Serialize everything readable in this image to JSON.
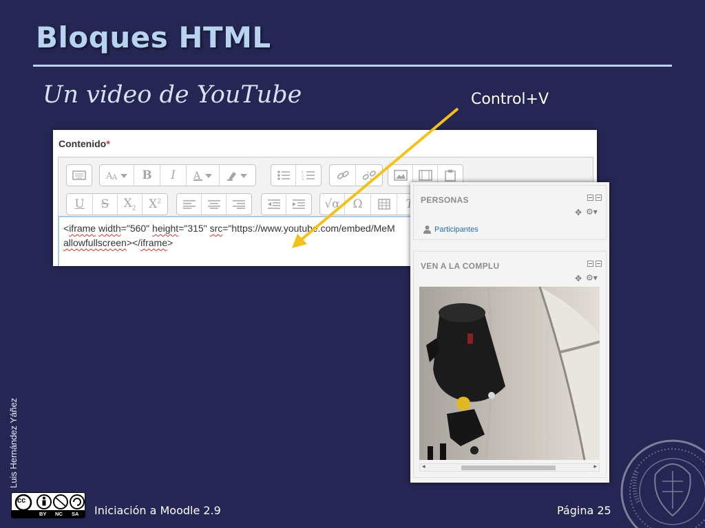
{
  "slide": {
    "title": "Bloques HTML",
    "subtitle": "Un video de YouTube",
    "shortcut_hint": "Control+V",
    "author": "Luis Hernández Yáñez",
    "course": "Iniciación a Moodle 2.9",
    "page": "Página 25"
  },
  "license": {
    "by": "BY",
    "nc": "NC",
    "sa": "SA",
    "cc": "cc"
  },
  "editor": {
    "field_label": "Contenido",
    "required_mark": "*",
    "code_line1": {
      "p1": "<",
      "w_iframe": "iframe",
      "p2": " ",
      "w_width": "width",
      "p3": "=\"560\" ",
      "w_height": "height",
      "p4": "=\"315\" ",
      "w_src": "src",
      "p5": "=\"https://www.youtube.com/embed/MeM"
    },
    "code_line2": {
      "w_allow": "allowfullscreen",
      "p6": "></",
      "w_iframe2": "iframe",
      "p7": ">"
    },
    "toolbar_rows": [
      [
        "toolbar-toggle",
        "font-size",
        "bold",
        "italic",
        "font-color",
        "background-color",
        "unordered-list",
        "ordered-list",
        "link",
        "unlink",
        "image",
        "media",
        "manage-files"
      ],
      [
        "underline",
        "strikethrough",
        "subscript",
        "superscript",
        "align-left",
        "align-center",
        "align-right",
        "outdent",
        "indent",
        "equation",
        "special-character",
        "table",
        "clear-formatting"
      ]
    ]
  },
  "sidebar": {
    "blocks": [
      {
        "title": "PERSONAS",
        "link": "Participantes"
      },
      {
        "title": "VEN A LA COMPLU"
      }
    ]
  },
  "colors": {
    "background": "#262654",
    "title": "#b7d3ef",
    "arrow": "#f2c21b",
    "link": "#1f6fae"
  }
}
